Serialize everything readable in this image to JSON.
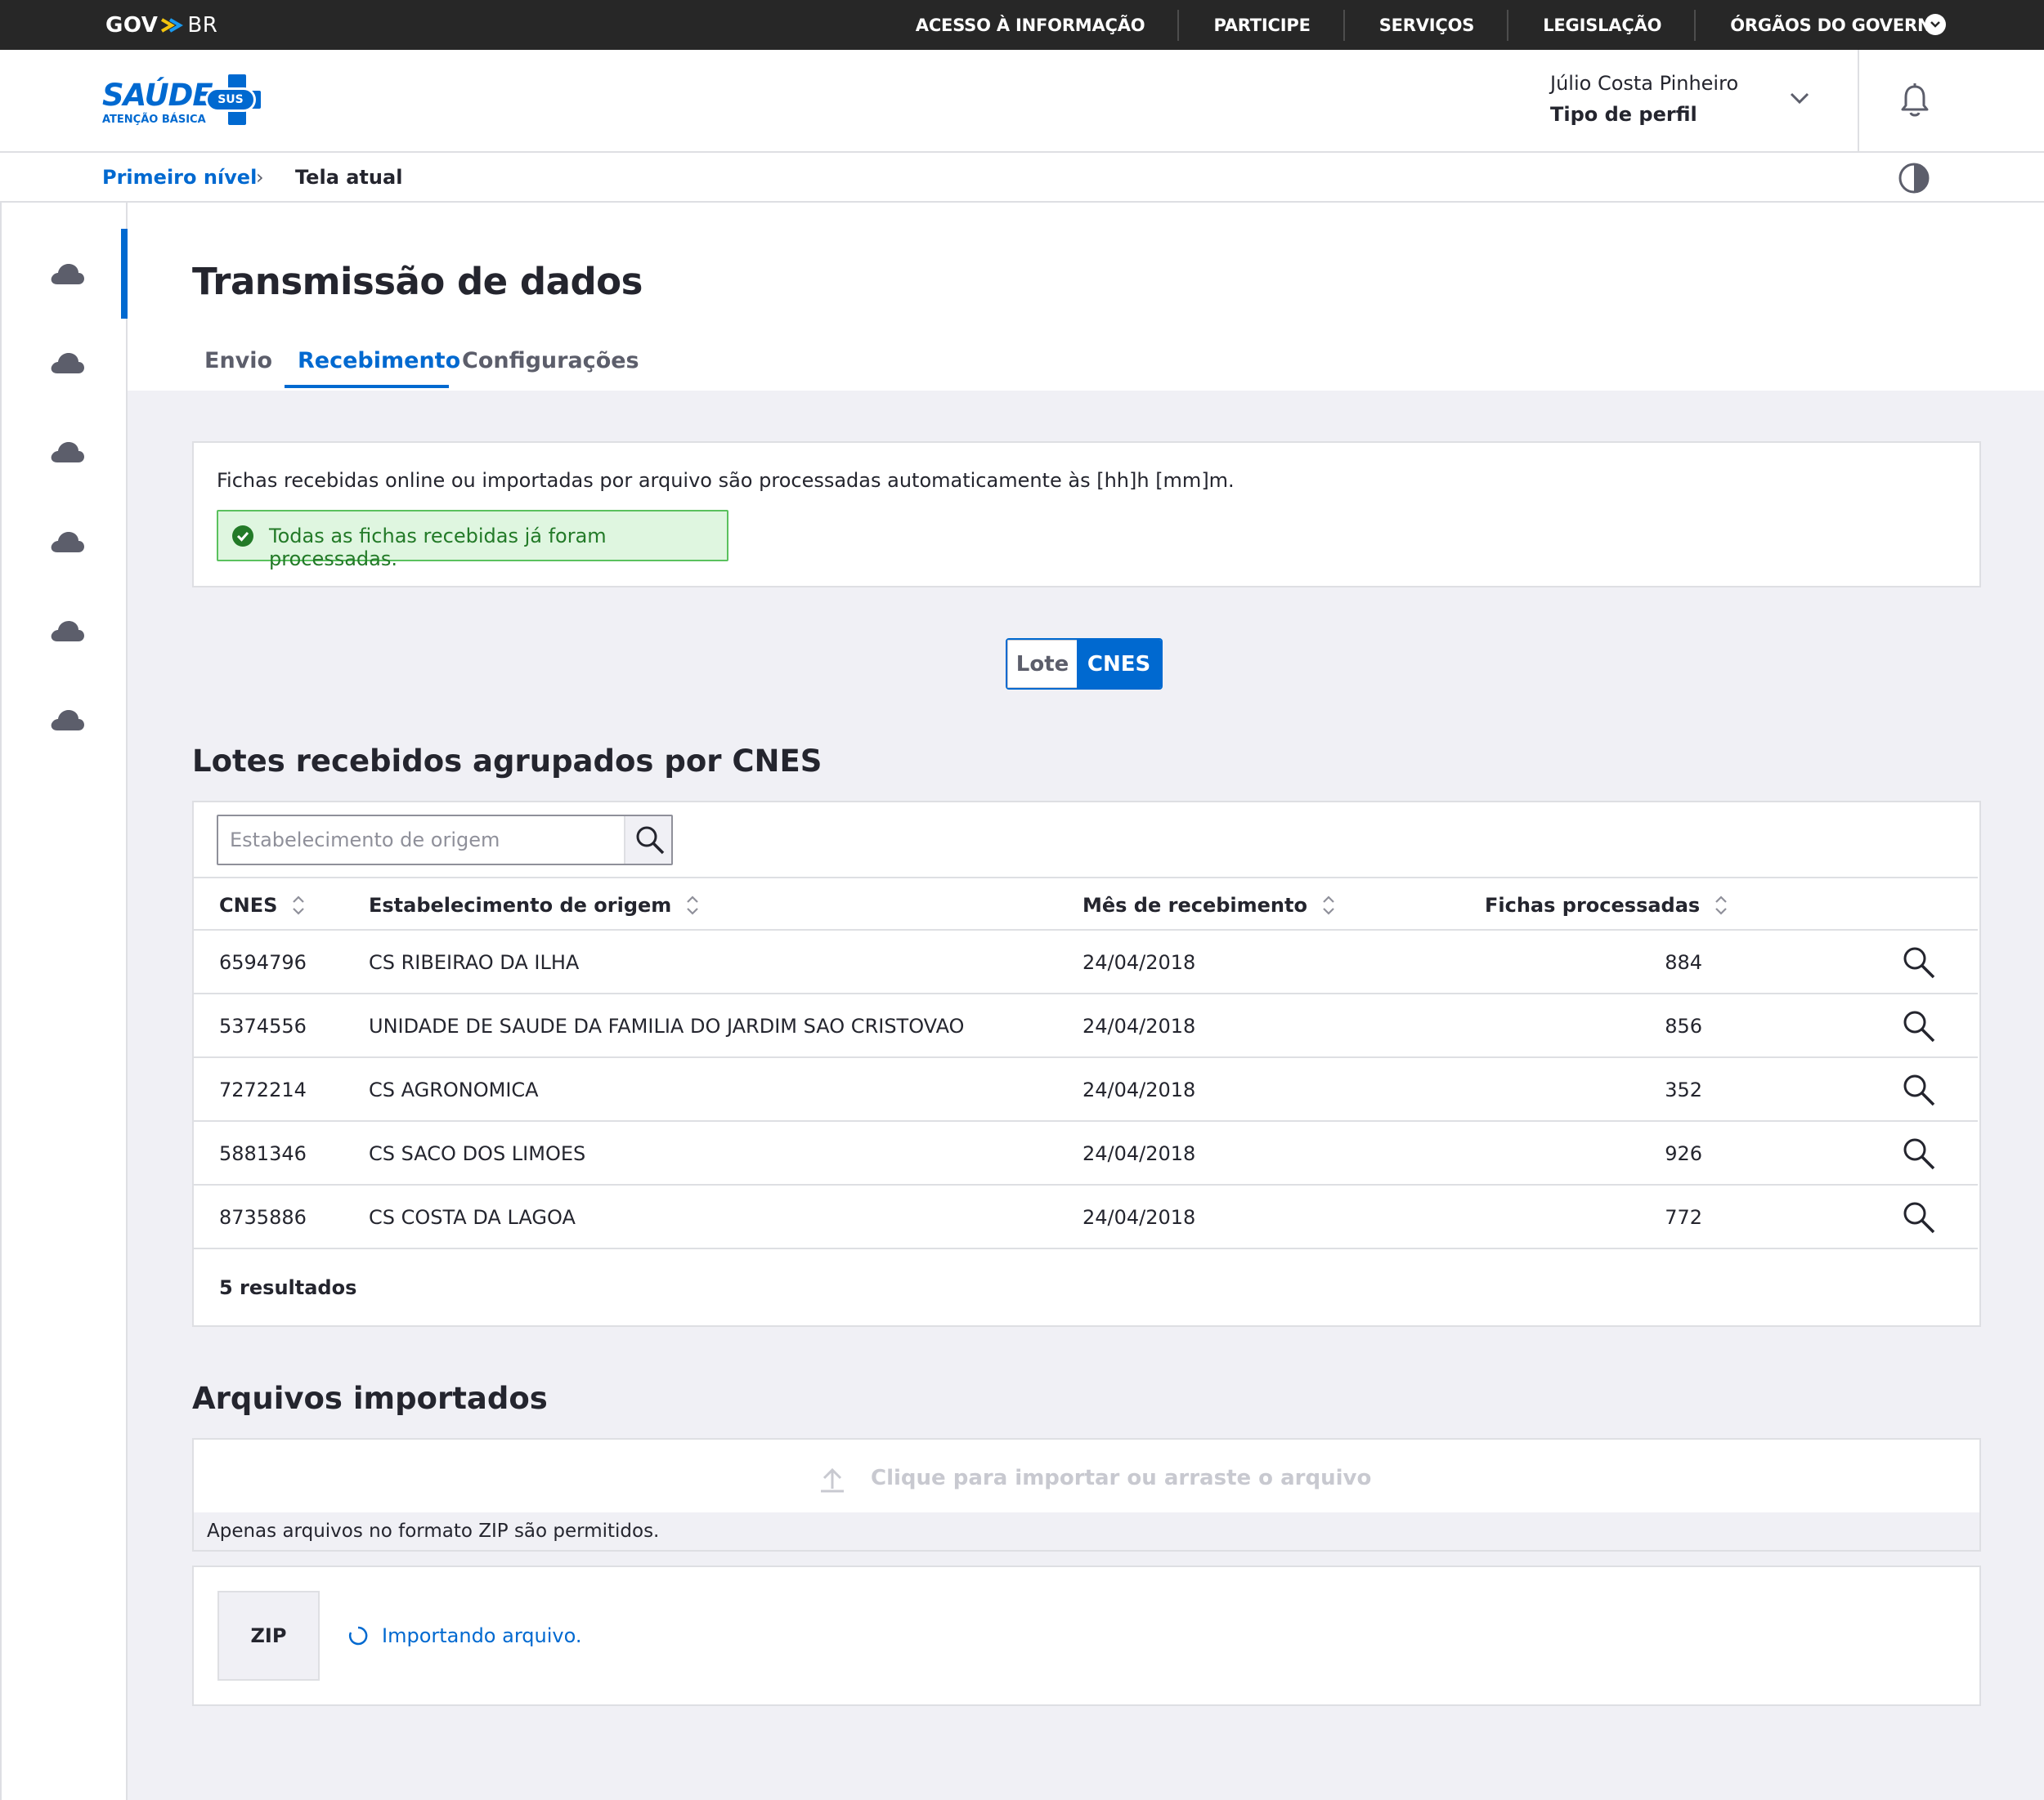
{
  "govbar": {
    "logo_gov": "GOV",
    "logo_br": "BR",
    "links": [
      "ACESSO À INFORMAÇÃO",
      "PARTICIPE",
      "SERVIÇOS",
      "LEGISLAÇÃO",
      "ÓRGÃOS DO GOVERNO"
    ]
  },
  "brand": {
    "name": "SAÚDE",
    "badge": "SUS",
    "subtitle": "ATENÇÃO BÁSICA"
  },
  "user": {
    "name": "Júlio Costa Pinheiro",
    "profile": "Tipo de perfil"
  },
  "breadcrumb": {
    "first": "Primeiro nível",
    "separator": "›",
    "current": "Tela atual"
  },
  "page": {
    "title": "Transmissão de dados",
    "tabs": [
      "Envio",
      "Recebimento",
      "Configurações"
    ],
    "active_tab": "Recebimento"
  },
  "info": {
    "text": "Fichas recebidas online ou importadas por arquivo são processadas automaticamente às [hh]h [mm]m.",
    "success": "Todas as fichas recebidas já foram processadas."
  },
  "toggle": {
    "options": [
      "Lote",
      "CNES"
    ],
    "selected": "CNES"
  },
  "lotes": {
    "title": "Lotes recebidos agrupados por CNES",
    "search_placeholder": "Estabelecimento de origem",
    "columns": [
      "CNES",
      "Estabelecimento de origem",
      "Mês de recebimento",
      "Fichas processadas"
    ],
    "rows": [
      {
        "cnes": "6594796",
        "estabelecimento": "CS RIBEIRAO DA ILHA",
        "mes": "24/04/2018",
        "fichas": "884"
      },
      {
        "cnes": "5374556",
        "estabelecimento": "UNIDADE DE SAUDE DA FAMILIA DO JARDIM SAO CRISTOVAO",
        "mes": "24/04/2018",
        "fichas": "856"
      },
      {
        "cnes": "7272214",
        "estabelecimento": "CS AGRONOMICA",
        "mes": "24/04/2018",
        "fichas": "352"
      },
      {
        "cnes": "5881346",
        "estabelecimento": "CS SACO DOS LIMOES",
        "mes": "24/04/2018",
        "fichas": "926"
      },
      {
        "cnes": "8735886",
        "estabelecimento": "CS COSTA DA LAGOA",
        "mes": "24/04/2018",
        "fichas": "772"
      }
    ],
    "result_count": "5 resultados"
  },
  "arquivos": {
    "title": "Arquivos importados",
    "dropzone": "Clique para importar ou arraste o arquivo",
    "note": "Apenas arquivos no formato ZIP são permitidos.",
    "file_type": "ZIP",
    "status": "Importando arquivo."
  },
  "colors": {
    "primary": "#0069d0",
    "govbar": "#272727",
    "success_bg": "#dff6e0",
    "success_border": "#5ac15e",
    "page_bg": "#f0f0f5"
  },
  "icons": [
    "cloud-icon",
    "search-icon",
    "chevron-down-icon",
    "bell-icon",
    "contrast-icon",
    "check-circle-icon",
    "sort-icon",
    "upload-icon",
    "spinner-icon"
  ]
}
